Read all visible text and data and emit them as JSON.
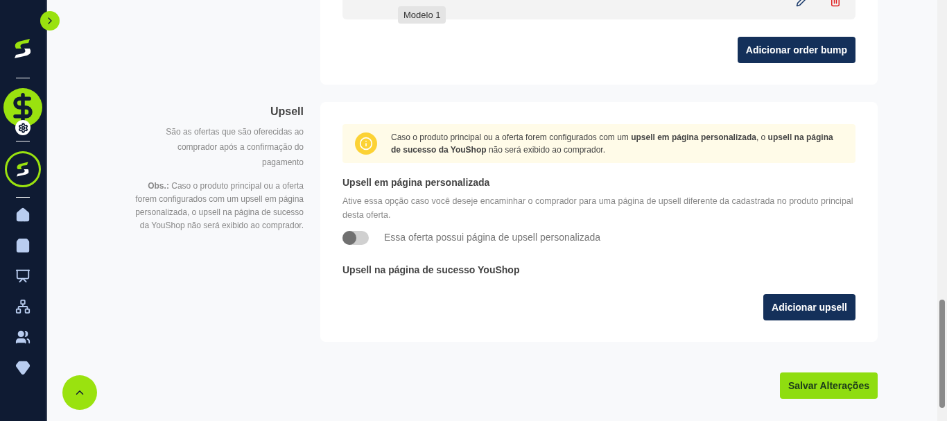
{
  "order_bump_card": {
    "row": {
      "badge": "Modelo 1"
    },
    "add_button": "Adicionar order bump"
  },
  "upsell": {
    "title": "Upsell",
    "description": "São as ofertas que são oferecidas ao comprador após a confirmação do pagamento",
    "note": "**Obs.:** Caso o produto principal ou a oferta forem configurados com um upsell em página personalizada, o upsell na página de sucesso da YouShop não será exibido ao comprador.",
    "alert": "Caso o produto principal ou a oferta forem configurados com um **upsell em página personalizada**, o **upsell na página de sucesso da YouShop** não será exibido ao comprador.",
    "custom_page": {
      "heading": "Upsell em página personalizada",
      "help": "Ative essa opção caso você deseje encaminhar o comprador para uma página de upsell diferente da cadastrada no produto principal desta oferta.",
      "toggle_label": "Essa oferta possui página de upsell personalizada",
      "on": false
    },
    "success_page": {
      "heading": "Upsell na página de sucesso YouShop"
    },
    "add_button": "Adicionar upsell"
  },
  "save_button": "Salvar Alterações"
}
